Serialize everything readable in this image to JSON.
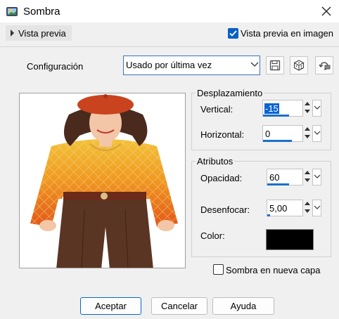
{
  "window": {
    "title": "Sombra"
  },
  "preview_toggle": {
    "label": "Vista previa"
  },
  "preview_in_image": {
    "label": "Vista previa en imagen",
    "checked": true
  },
  "config": {
    "label": "Configuración",
    "value": "Usado por última vez"
  },
  "displacement": {
    "group_title": "Desplazamiento",
    "vertical": {
      "label": "Vertical:",
      "value": "-15"
    },
    "horizontal": {
      "label": "Horizontal:",
      "value": "0"
    }
  },
  "attributes": {
    "group_title": "Atributos",
    "opacity": {
      "label": "Opacidad:",
      "value": "60"
    },
    "blur": {
      "label": "Desenfocar:",
      "value": "5,00"
    },
    "color": {
      "label": "Color:",
      "value": "#000000"
    }
  },
  "new_layer": {
    "label": "Sombra en nueva capa",
    "checked": false
  },
  "buttons": {
    "ok": "Aceptar",
    "cancel": "Cancelar",
    "help": "Ayuda"
  },
  "colors": {
    "accent": "#0a64d2"
  }
}
